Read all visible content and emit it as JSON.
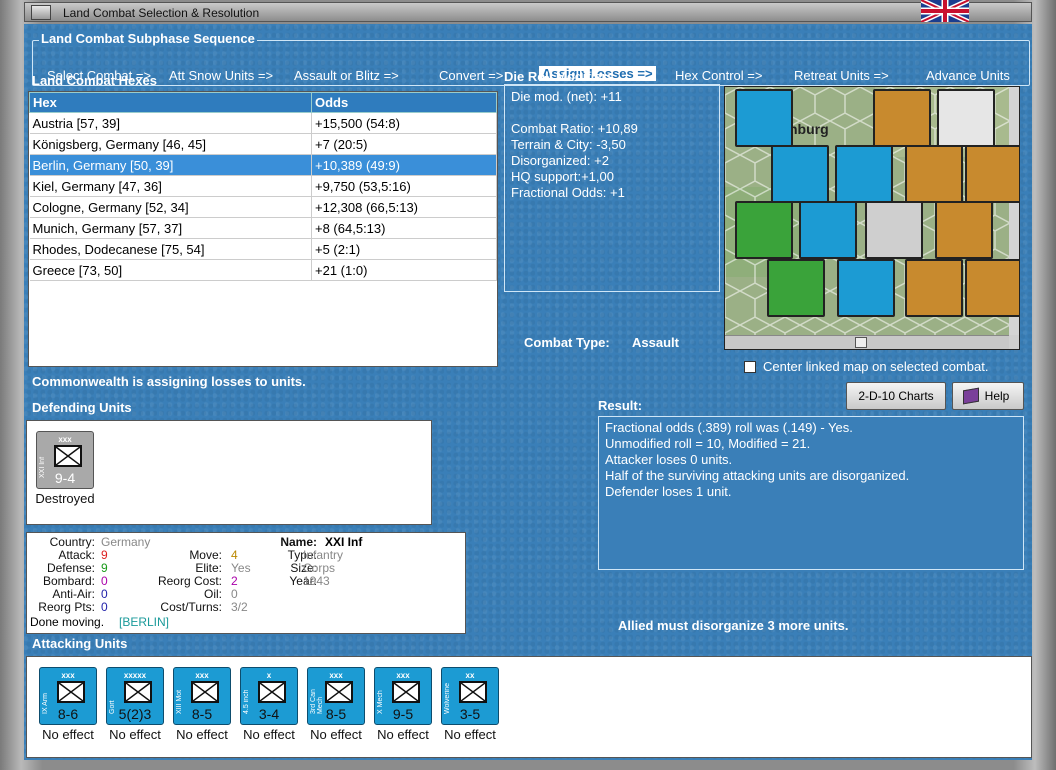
{
  "window": {
    "title": "Land Combat Selection & Resolution"
  },
  "sequence": {
    "title": "Land Combat Subphase Sequence",
    "steps": [
      "Select Combat =>",
      "Att Snow Units =>",
      "Assault or Blitz =>",
      "Convert =>",
      "Assign Losses =>",
      "Hex Control =>",
      "Retreat Units =>",
      "Advance Units"
    ],
    "active_index": 4
  },
  "hexes": {
    "title": "Land Combat Hexes",
    "col_hex": "Hex",
    "col_odds": "Odds",
    "rows": [
      {
        "hex": "Austria [57, 39]",
        "odds": "+15,500 (54:8)"
      },
      {
        "hex": "Königsberg, Germany [46, 45]",
        "odds": "+7 (20:5)"
      },
      {
        "hex": "Berlin, Germany [50, 39]",
        "odds": "+10,389 (49:9)"
      },
      {
        "hex": "Kiel, Germany [47, 36]",
        "odds": "+9,750 (53,5:16)"
      },
      {
        "hex": "Cologne, Germany [52, 34]",
        "odds": "+12,308 (66,5:13)"
      },
      {
        "hex": "Munich, Germany [57, 37]",
        "odds": "+8 (64,5:13)"
      },
      {
        "hex": "Rhodes, Dodecanese [75, 54]",
        "odds": "+5 (2:1)"
      },
      {
        "hex": "Greece [73, 50]",
        "odds": "+21 (1:0)"
      }
    ],
    "selected_index": 2
  },
  "drm": {
    "title": "Die Roll Modifiers",
    "lines": [
      "Die mod. (net): +11",
      "",
      "Combat Ratio: +10,89",
      "Terrain & City: -3,50",
      "Disorganized: +2",
      "HQ support:+1,00",
      "Fractional Odds: +1"
    ]
  },
  "combat_type": {
    "label": "Combat Type:",
    "value": "Assault"
  },
  "center_linked": {
    "label": "Center linked map on selected combat.",
    "checked": false
  },
  "status": "Commonwealth is assigning losses to units.",
  "defending": {
    "title": "Defending Units",
    "units": [
      {
        "size": "xxx",
        "name": "XXI Inf",
        "value": "9-4",
        "result": "Destroyed",
        "color": "#a9a9a9"
      }
    ]
  },
  "unit_info": {
    "country_label": "Country:",
    "country": "Germany",
    "attack_label": "Attack:",
    "attack": "9",
    "defense_label": "Defense:",
    "defense": "9",
    "bombard_label": "Bombard:",
    "bombard": "0",
    "antiair_label": "Anti-Air:",
    "antiair": "0",
    "reorgpts_label": "Reorg Pts:",
    "reorgpts": "0",
    "move_label": "Move:",
    "move": "4",
    "elite_label": "Elite:",
    "elite": "Yes",
    "reorgcost_label": "Reorg Cost:",
    "reorgcost": "2",
    "oil_label": "Oil:",
    "oil": "0",
    "costturns_label": "Cost/Turns:",
    "costturns": "3/2",
    "name_label": "Name:",
    "name": "XXI Inf",
    "type_label": "Type:",
    "type": "Infantry",
    "size_label": "Size:",
    "size": "Corps",
    "year_label": "Year:",
    "year": "1943",
    "done": "Done moving.",
    "done_loc": "[BERLIN]"
  },
  "buttons": {
    "charts": "2-D-10 Charts",
    "help": "Help"
  },
  "result": {
    "title": "Result:",
    "lines": [
      "Fractional odds (.389) roll was (.149)  - Yes.",
      "Unmodified roll = 10, Modified = 21.",
      "Attacker loses 0 units.",
      "Half of the surviving attacking units are disorganized.",
      "Defender loses 1 unit."
    ]
  },
  "allied_msg": "Allied must disorganize 3 more units.",
  "attacking": {
    "title": "Attacking Units",
    "units": [
      {
        "size": "xxx",
        "name": "IX Arm",
        "value": "8-6",
        "result": "No effect"
      },
      {
        "size": "xxxxx",
        "name": "Gort",
        "value": "5(2)3",
        "result": "No effect"
      },
      {
        "size": "xxx",
        "name": "XIII Mot",
        "value": "8-5",
        "result": "No effect"
      },
      {
        "size": "x",
        "name": "4.5 inch",
        "value": "3-4",
        "result": "No effect"
      },
      {
        "size": "xxx",
        "name": "3rd Can Mech",
        "value": "8-5",
        "result": "No effect"
      },
      {
        "size": "xxx",
        "name": "X Mech",
        "value": "9-5",
        "result": "No effect"
      },
      {
        "size": "xx",
        "name": "Wolverine",
        "value": "3-5",
        "result": "No effect"
      }
    ]
  },
  "map": {
    "city_label": "nburg"
  }
}
